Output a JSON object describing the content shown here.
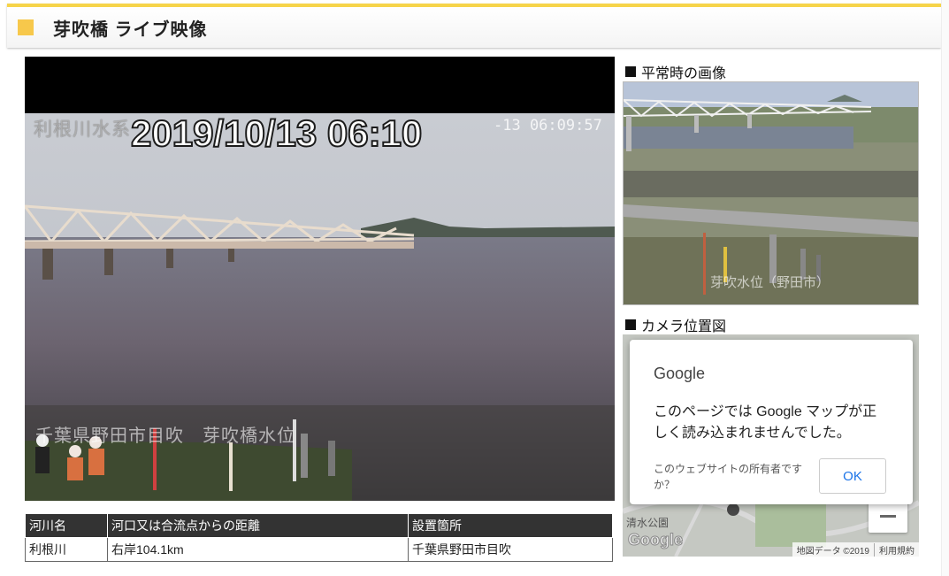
{
  "header": {
    "title": "芽吹橋 ライブ映像"
  },
  "video": {
    "overlay_title": "利根川水系",
    "overlay_datetime": "2019/10/13 06:10",
    "overlay_time": "-13 06:09:57",
    "overlay_location": "千葉県野田市目吹　芽吹橋水位"
  },
  "info_table": {
    "headers": [
      "河川名",
      "河口又は合流点からの距離",
      "設置箇所"
    ],
    "row": [
      "利根川",
      "右岸104.1km",
      "千葉県野田市目吹"
    ]
  },
  "normal_image": {
    "heading": "平常時の画像",
    "caption": "芽吹水位（野田市）"
  },
  "camera_map": {
    "heading": "カメラ位置図",
    "dialog_brand": "Google",
    "dialog_message": "このページでは Google マップが正しく読み込まれませんでした。",
    "dialog_owner_question": "このウェブサイトの所有者ですか？",
    "ok_label": "OK",
    "place_label": "清水公園",
    "logo_text": "Google",
    "map_data": "地図データ ©2019",
    "terms": "利用規約"
  },
  "colors": {
    "accent": "#f7c84b",
    "header_border": "#f6d44a",
    "table_header": "#333333",
    "link_blue": "#1a73e8"
  }
}
